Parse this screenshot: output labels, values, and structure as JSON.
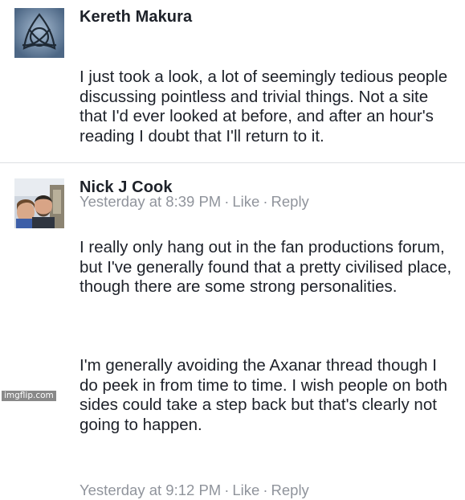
{
  "comments": [
    {
      "author": "Kereth Makura",
      "paragraphs": [
        "I just took a look, a lot of seemingly tedious people discussing pointless and trivial things. Not a site that I'd ever looked at before, and after an hour's reading I doubt that I'll return to it."
      ],
      "timestamp": "Yesterday at 8:39 PM",
      "like_label": "Like",
      "reply_label": "Reply",
      "separator": "·",
      "avatar_icon": "celtic-knot-icon"
    },
    {
      "author": "Nick J Cook",
      "paragraphs": [
        "I really only hang out in the fan productions forum, but I've generally found that a pretty civilised place, though there are some strong personalities.",
        "I'm generally avoiding the Axanar thread though I do peek in from time to time. I wish people on both sides could take a step back but that's clearly not going to happen."
      ],
      "timestamp": "Yesterday at 9:12 PM",
      "like_label": "Like",
      "reply_label": "Reply",
      "separator": "·",
      "avatar_icon": "profile-photo"
    }
  ],
  "watermark": "imgflip.com",
  "colors": {
    "text": "#1d2129",
    "meta": "#90949c",
    "divider": "#dddfe2"
  }
}
